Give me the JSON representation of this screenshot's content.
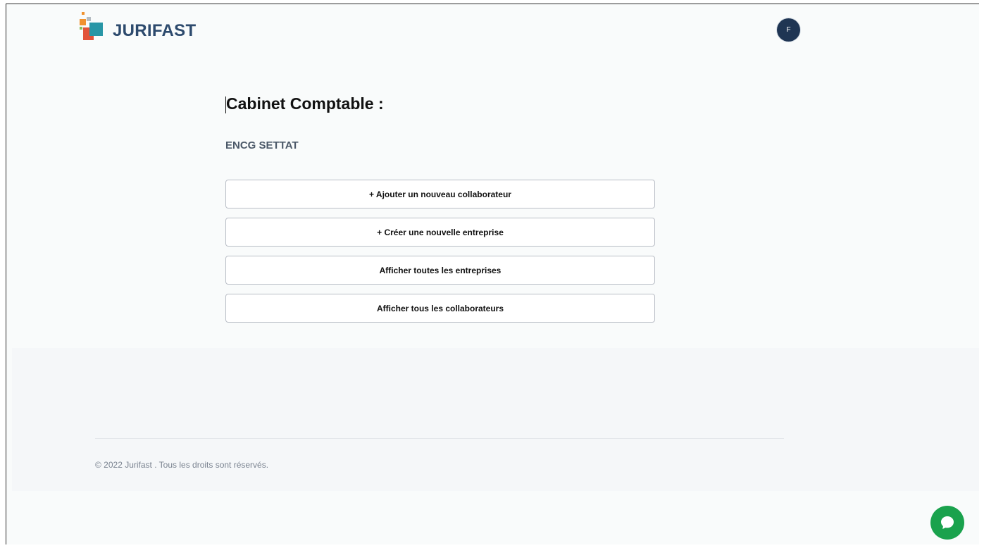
{
  "header": {
    "brand_name": "JURIFAST",
    "user_initial": "F"
  },
  "main": {
    "title": "Cabinet Comptable :",
    "company_name": "ENCG SETTAT",
    "actions": [
      {
        "label": "+ Ajouter un nouveau collaborateur"
      },
      {
        "label": "+ Créer une nouvelle entreprise"
      },
      {
        "label": "Afficher toutes les entreprises"
      },
      {
        "label": "Afficher tous les collaborateurs"
      }
    ]
  },
  "footer": {
    "copyright": "© 2022 Jurifast . Tous les droits sont réservés."
  },
  "icons": {
    "logo": "jurifast-logo-icon",
    "chat": "chat-bubble-icon"
  },
  "colors": {
    "brand_text": "#2d4a6d",
    "avatar_bg": "#1f3553",
    "chat_bg": "#1aa24d",
    "logo_orange": "#f0922f",
    "logo_red": "#e2533a",
    "logo_teal": "#2896a6",
    "logo_green": "#8cbf5a"
  }
}
